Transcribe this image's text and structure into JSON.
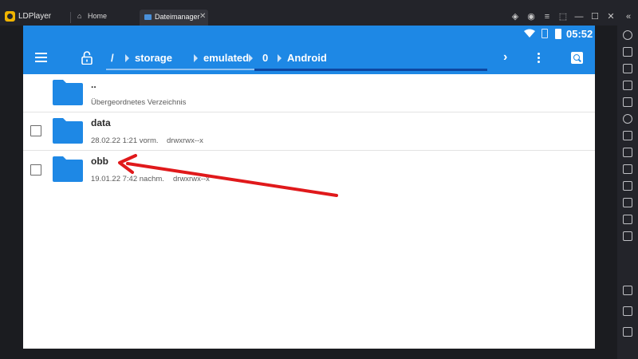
{
  "titlebar": {
    "app_name": "LDPlayer",
    "tabs": [
      {
        "label": "Home"
      },
      {
        "label": "Dateimanager"
      }
    ]
  },
  "statusbar": {
    "time": "05:52"
  },
  "appbar": {
    "path": [
      "/",
      "storage",
      "emulated",
      "0",
      "Android"
    ]
  },
  "list": {
    "items": [
      {
        "name": "..",
        "meta": "Übergeordnetes Verzeichnis",
        "perm": ""
      },
      {
        "name": "data",
        "meta": "28.02.22 1:21 vorm.",
        "perm": "drwxrwx--x"
      },
      {
        "name": "obb",
        "meta": "19.01.22 7:42 nachm.",
        "perm": "drwxrwx--x"
      }
    ]
  },
  "colors": {
    "accent": "#1e88e5",
    "folder": "#1e88e5",
    "annotation_arrow": "#e0191b"
  },
  "icons": {
    "menu": "menu-icon",
    "lock": "lock-icon",
    "more": "more-vert-icon",
    "search": "search-icon",
    "forward": "chevron-right-icon"
  }
}
